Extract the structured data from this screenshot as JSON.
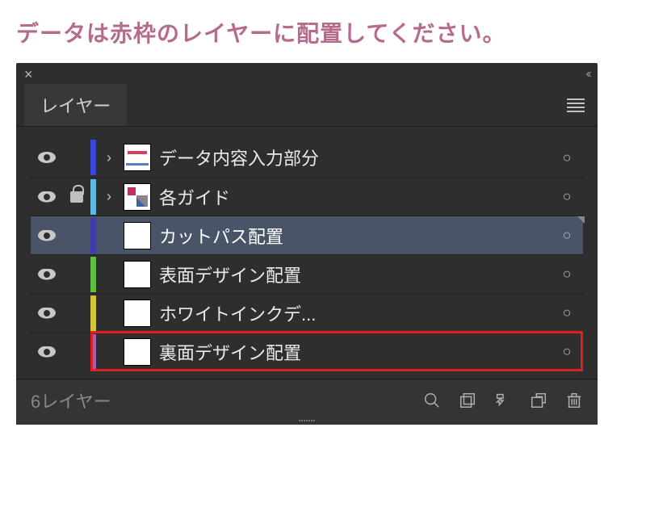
{
  "instruction": "データは赤枠のレイヤーに配置してください。",
  "panel": {
    "tab_label": "レイヤー",
    "layer_count_label": "6レイヤー"
  },
  "layers": [
    {
      "name": "データ内容入力部分",
      "color": "#3a46d6",
      "visible": true,
      "locked": false,
      "expandable": true,
      "selected": false,
      "thumb": "art1"
    },
    {
      "name": "各ガイド",
      "color": "#5bb9e0",
      "visible": true,
      "locked": true,
      "expandable": true,
      "selected": false,
      "thumb": "art2"
    },
    {
      "name": "カットパス配置",
      "color": "#3d3db0",
      "visible": true,
      "locked": false,
      "expandable": false,
      "selected": true,
      "thumb": "blank"
    },
    {
      "name": "表面デザイン配置",
      "color": "#5fbf3f",
      "visible": true,
      "locked": false,
      "expandable": false,
      "selected": false,
      "thumb": "blank"
    },
    {
      "name": "ホワイトインクデ...",
      "color": "#d6c23a",
      "visible": true,
      "locked": false,
      "expandable": false,
      "selected": false,
      "thumb": "blank"
    },
    {
      "name": "裏面デザイン配置",
      "color": "#9d5fb8",
      "visible": true,
      "locked": false,
      "expandable": false,
      "selected": false,
      "thumb": "blank",
      "highlighted": true
    }
  ]
}
